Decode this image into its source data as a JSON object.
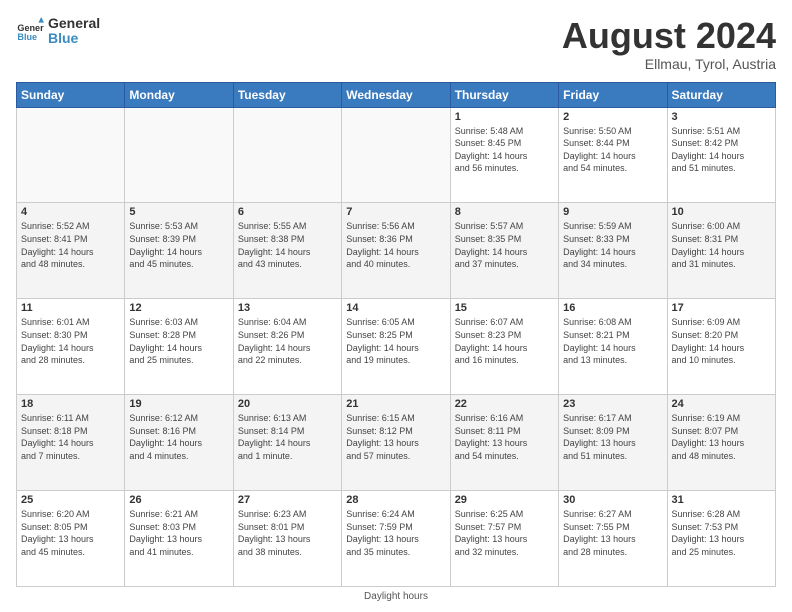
{
  "logo": {
    "text_general": "General",
    "text_blue": "Blue"
  },
  "header": {
    "month_year": "August 2024",
    "location": "Ellmau, Tyrol, Austria"
  },
  "weekdays": [
    "Sunday",
    "Monday",
    "Tuesday",
    "Wednesday",
    "Thursday",
    "Friday",
    "Saturday"
  ],
  "footer": {
    "note": "Daylight hours"
  },
  "weeks": [
    [
      {
        "day": "",
        "info": ""
      },
      {
        "day": "",
        "info": ""
      },
      {
        "day": "",
        "info": ""
      },
      {
        "day": "",
        "info": ""
      },
      {
        "day": "1",
        "info": "Sunrise: 5:48 AM\nSunset: 8:45 PM\nDaylight: 14 hours\nand 56 minutes."
      },
      {
        "day": "2",
        "info": "Sunrise: 5:50 AM\nSunset: 8:44 PM\nDaylight: 14 hours\nand 54 minutes."
      },
      {
        "day": "3",
        "info": "Sunrise: 5:51 AM\nSunset: 8:42 PM\nDaylight: 14 hours\nand 51 minutes."
      }
    ],
    [
      {
        "day": "4",
        "info": "Sunrise: 5:52 AM\nSunset: 8:41 PM\nDaylight: 14 hours\nand 48 minutes."
      },
      {
        "day": "5",
        "info": "Sunrise: 5:53 AM\nSunset: 8:39 PM\nDaylight: 14 hours\nand 45 minutes."
      },
      {
        "day": "6",
        "info": "Sunrise: 5:55 AM\nSunset: 8:38 PM\nDaylight: 14 hours\nand 43 minutes."
      },
      {
        "day": "7",
        "info": "Sunrise: 5:56 AM\nSunset: 8:36 PM\nDaylight: 14 hours\nand 40 minutes."
      },
      {
        "day": "8",
        "info": "Sunrise: 5:57 AM\nSunset: 8:35 PM\nDaylight: 14 hours\nand 37 minutes."
      },
      {
        "day": "9",
        "info": "Sunrise: 5:59 AM\nSunset: 8:33 PM\nDaylight: 14 hours\nand 34 minutes."
      },
      {
        "day": "10",
        "info": "Sunrise: 6:00 AM\nSunset: 8:31 PM\nDaylight: 14 hours\nand 31 minutes."
      }
    ],
    [
      {
        "day": "11",
        "info": "Sunrise: 6:01 AM\nSunset: 8:30 PM\nDaylight: 14 hours\nand 28 minutes."
      },
      {
        "day": "12",
        "info": "Sunrise: 6:03 AM\nSunset: 8:28 PM\nDaylight: 14 hours\nand 25 minutes."
      },
      {
        "day": "13",
        "info": "Sunrise: 6:04 AM\nSunset: 8:26 PM\nDaylight: 14 hours\nand 22 minutes."
      },
      {
        "day": "14",
        "info": "Sunrise: 6:05 AM\nSunset: 8:25 PM\nDaylight: 14 hours\nand 19 minutes."
      },
      {
        "day": "15",
        "info": "Sunrise: 6:07 AM\nSunset: 8:23 PM\nDaylight: 14 hours\nand 16 minutes."
      },
      {
        "day": "16",
        "info": "Sunrise: 6:08 AM\nSunset: 8:21 PM\nDaylight: 14 hours\nand 13 minutes."
      },
      {
        "day": "17",
        "info": "Sunrise: 6:09 AM\nSunset: 8:20 PM\nDaylight: 14 hours\nand 10 minutes."
      }
    ],
    [
      {
        "day": "18",
        "info": "Sunrise: 6:11 AM\nSunset: 8:18 PM\nDaylight: 14 hours\nand 7 minutes."
      },
      {
        "day": "19",
        "info": "Sunrise: 6:12 AM\nSunset: 8:16 PM\nDaylight: 14 hours\nand 4 minutes."
      },
      {
        "day": "20",
        "info": "Sunrise: 6:13 AM\nSunset: 8:14 PM\nDaylight: 14 hours\nand 1 minute."
      },
      {
        "day": "21",
        "info": "Sunrise: 6:15 AM\nSunset: 8:12 PM\nDaylight: 13 hours\nand 57 minutes."
      },
      {
        "day": "22",
        "info": "Sunrise: 6:16 AM\nSunset: 8:11 PM\nDaylight: 13 hours\nand 54 minutes."
      },
      {
        "day": "23",
        "info": "Sunrise: 6:17 AM\nSunset: 8:09 PM\nDaylight: 13 hours\nand 51 minutes."
      },
      {
        "day": "24",
        "info": "Sunrise: 6:19 AM\nSunset: 8:07 PM\nDaylight: 13 hours\nand 48 minutes."
      }
    ],
    [
      {
        "day": "25",
        "info": "Sunrise: 6:20 AM\nSunset: 8:05 PM\nDaylight: 13 hours\nand 45 minutes."
      },
      {
        "day": "26",
        "info": "Sunrise: 6:21 AM\nSunset: 8:03 PM\nDaylight: 13 hours\nand 41 minutes."
      },
      {
        "day": "27",
        "info": "Sunrise: 6:23 AM\nSunset: 8:01 PM\nDaylight: 13 hours\nand 38 minutes."
      },
      {
        "day": "28",
        "info": "Sunrise: 6:24 AM\nSunset: 7:59 PM\nDaylight: 13 hours\nand 35 minutes."
      },
      {
        "day": "29",
        "info": "Sunrise: 6:25 AM\nSunset: 7:57 PM\nDaylight: 13 hours\nand 32 minutes."
      },
      {
        "day": "30",
        "info": "Sunrise: 6:27 AM\nSunset: 7:55 PM\nDaylight: 13 hours\nand 28 minutes."
      },
      {
        "day": "31",
        "info": "Sunrise: 6:28 AM\nSunset: 7:53 PM\nDaylight: 13 hours\nand 25 minutes."
      }
    ]
  ]
}
